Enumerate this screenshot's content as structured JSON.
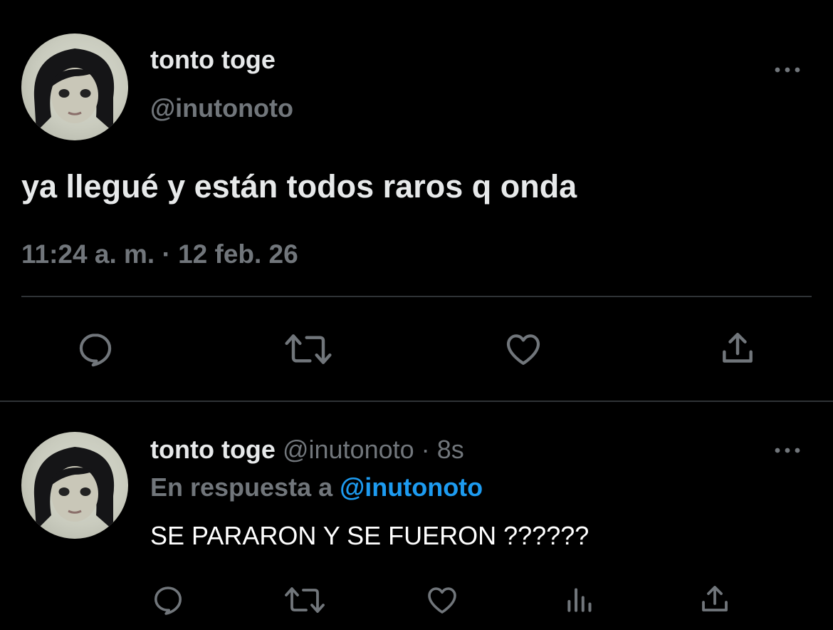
{
  "main_tweet": {
    "author_name": "tonto toge",
    "handle": "@inutonoto",
    "text": "ya llegué y están todos raros q onda",
    "timestamp": "11:24 a. m. · 12 feb. 26",
    "actions": [
      "reply-icon",
      "retweet-icon",
      "like-icon",
      "share-icon"
    ]
  },
  "reply_tweet": {
    "author_name": "tonto toge",
    "handle": "@inutonoto",
    "separator": "·",
    "age": "8s",
    "in_reply_prefix": "En respuesta a",
    "in_reply_handle": "@inutonoto",
    "text": "SE PARARON Y SE FUERON ??????",
    "actions": [
      "reply-icon",
      "retweet-icon",
      "like-icon",
      "views-icon",
      "share-icon"
    ]
  },
  "colors": {
    "background": "#000000",
    "text": "#e7e9ea",
    "muted": "#71767b",
    "link": "#1d9bf0",
    "divider": "#2f3336"
  }
}
